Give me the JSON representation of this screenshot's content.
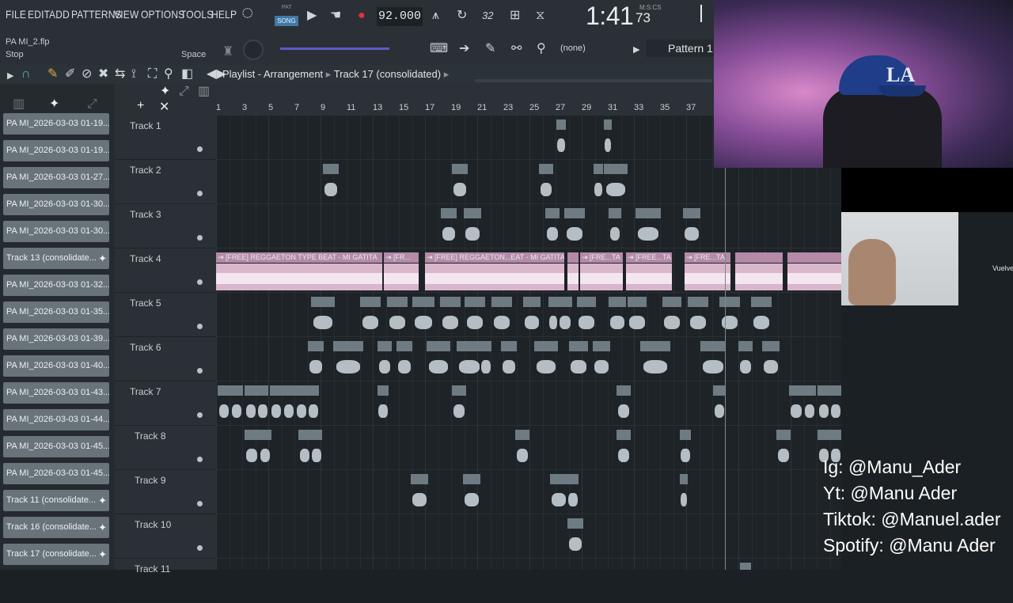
{
  "menu": [
    "FILE",
    "EDIT",
    "ADD",
    "PATTERNS",
    "VIEW",
    "OPTIONS",
    "TOOLS",
    "HELP"
  ],
  "transport": {
    "pat_label": "PAT",
    "song_label": "SONG",
    "tempo": "92.000",
    "time": "1:41",
    "time_cs": "73",
    "time_format": "M:S:CS",
    "cpu": "32"
  },
  "file": {
    "name": "PA MI_2.flp",
    "status": "Stop",
    "hint": "Space"
  },
  "pattern_selector": {
    "snap_value": "(none)",
    "pattern": "Pattern 1"
  },
  "playlist": {
    "title": "Playlist - Arrangement",
    "track_label": "Track 17 (consolidated)"
  },
  "channels": [
    "PA MI_2026-03-03 01-19...",
    "PA MI_2026-03-03 01-19...",
    "PA MI_2026-03-03 01-27...",
    "PA MI_2026-03-03 01-30...",
    "PA MI_2026-03-03 01-30...",
    "Track 13 (consolidate...",
    "PA MI_2026-03-03 01-32...",
    "PA MI_2026-03-03 01-35...",
    "PA MI_2026-03-03 01-39...",
    "PA MI_2026-03-03 01-40...",
    "PA MI_2026-03-03 01-43...",
    "PA MI_2026-03-03 01-44...",
    "PA MI_2026-03-03 01-45...",
    "PA MI_2026-03-03 01-45...",
    "Track 11 (consolidate...",
    "Track 16 (consolidate...",
    "Track 17 (consolidate..."
  ],
  "tracks": [
    "Track 1",
    "Track 2",
    "Track 3",
    "Track 4",
    "Track 5",
    "Track 6",
    "Track 7",
    "Track 8",
    "Track 9",
    "Track 10",
    "Track 11"
  ],
  "ruler_ticks": [
    "1",
    "3",
    "5",
    "7",
    "9",
    "11",
    "13",
    "15",
    "17",
    "19",
    "21",
    "23",
    "25",
    "27",
    "29",
    "31",
    "33",
    "35",
    "37"
  ],
  "clip_titles": {
    "main": "[FREE] REGGAETON TYPE BEAT - MI GATITA",
    "short1": "[FR...",
    "mid": "[FREE] REGGAETON...EAT - MI GATITA",
    "short2": "[FRE...TA",
    "short3": "[FREE...TA",
    "short4": "[FRE...TA"
  },
  "social": {
    "ig": "Ig: @Manu_Ader",
    "yt": "Yt: @Manu Ader",
    "tiktok": "Tiktok: @Manuel.ader",
    "spotify": "Spotify: @Manu Ader"
  },
  "overlay_text": "Vuelve",
  "webcam_logo": "LA",
  "colors": {
    "accent": "#5a5cc7",
    "clip": "#6f7b83",
    "audio_clip": "#d9b6cc",
    "background": "#1e2327"
  }
}
